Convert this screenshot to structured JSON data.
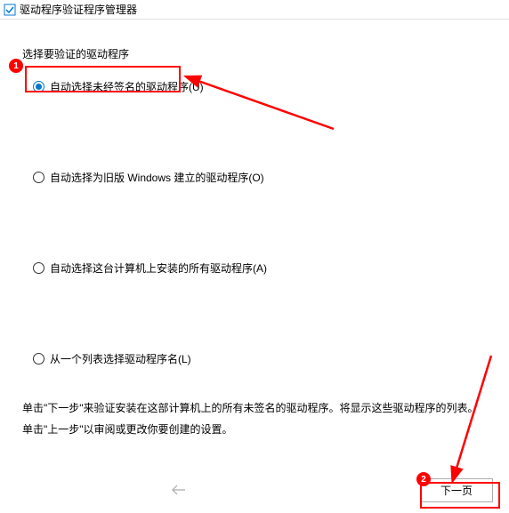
{
  "titlebar": {
    "title": "驱动程序验证程序管理器"
  },
  "group_label": "选择要验证的驱动程序",
  "options": {
    "opt1": "自动选择未经签名的驱动程序(U)",
    "opt2": "自动选择为旧版 Windows 建立的驱动程序(O)",
    "opt3": "自动选择这台计算机上安装的所有驱动程序(A)",
    "opt4": "从一个列表选择驱动程序名(L)"
  },
  "hints": {
    "line1": "单击\"下一步\"来验证安装在这部计算机上的所有未签名的驱动程序。将显示这些驱动程序的列表。",
    "line2": "单击\"上一步\"以审阅或更改你要创建的设置。"
  },
  "buttons": {
    "next": "下一页"
  },
  "annotations": {
    "badge1": "1",
    "badge2": "2"
  }
}
